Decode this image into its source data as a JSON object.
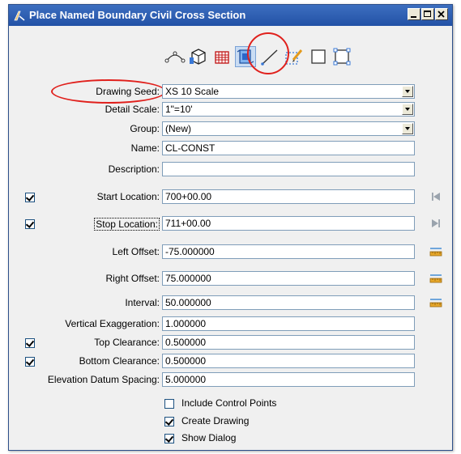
{
  "window": {
    "title": "Place Named Boundary Civil Cross Section"
  },
  "toolbar": {
    "icons": [
      "civil-route-icon",
      "cube-icon",
      "grid-icon",
      "cross-section-icon",
      "line-icon",
      "dashed-box-icon",
      "square-icon",
      "rectangle-icon"
    ],
    "selected": "cross-section-icon"
  },
  "fields": {
    "drawing_seed": {
      "label": "Drawing Seed:",
      "value": "XS 10 Scale"
    },
    "detail_scale": {
      "label": "Detail Scale:",
      "value": "1\"=10'"
    },
    "group": {
      "label": "Group:",
      "value": "(New)"
    },
    "name": {
      "label": "Name:",
      "value": "CL-CONST"
    },
    "description": {
      "label": "Description:",
      "value": ""
    },
    "start_location": {
      "label": "Start Location:",
      "value": "700+00.00",
      "checked": true
    },
    "stop_location": {
      "label": "Stop Location:",
      "value": "711+00.00",
      "checked": true
    },
    "left_offset": {
      "label": "Left Offset:",
      "value": "-75.000000"
    },
    "right_offset": {
      "label": "Right Offset:",
      "value": "75.000000"
    },
    "interval": {
      "label": "Interval:",
      "value": "50.000000"
    },
    "vertical_exaggeration": {
      "label": "Vertical Exaggeration:",
      "value": "1.000000"
    },
    "top_clearance": {
      "label": "Top Clearance:",
      "value": "0.500000",
      "checked": true
    },
    "bottom_clearance": {
      "label": "Bottom Clearance:",
      "value": "0.500000",
      "checked": true
    },
    "elevation_datum_spacing": {
      "label": "Elevation Datum Spacing:",
      "value": "5.000000"
    }
  },
  "options": {
    "include_control_points": {
      "label": "Include Control Points",
      "checked": false
    },
    "create_drawing": {
      "label": "Create Drawing",
      "checked": true
    },
    "show_dialog": {
      "label": "Show Dialog",
      "checked": true
    }
  },
  "colors": {
    "title_bar": "#2251a6",
    "highlight": "#e0201c",
    "dialog_bg": "#f0f0f0"
  }
}
